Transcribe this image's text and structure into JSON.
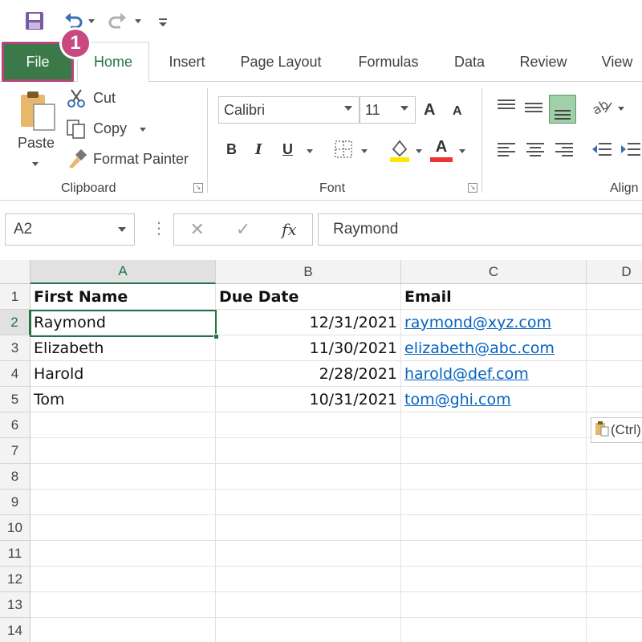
{
  "quick_access": {
    "save_icon": "save-icon",
    "undo_icon": "undo-icon",
    "redo_icon": "redo-icon",
    "customize_icon": "customize-qat-icon"
  },
  "tabs": [
    {
      "label": "File",
      "active": false
    },
    {
      "label": "Home",
      "active": true
    },
    {
      "label": "Insert"
    },
    {
      "label": "Page Layout"
    },
    {
      "label": "Formulas"
    },
    {
      "label": "Data"
    },
    {
      "label": "Review"
    },
    {
      "label": "View"
    }
  ],
  "step_badge": "1",
  "ribbon": {
    "clipboard": {
      "label": "Clipboard",
      "paste": "Paste",
      "cut": "Cut",
      "copy": "Copy",
      "format_painter": "Format Painter"
    },
    "font": {
      "label": "Font",
      "font_name": "Calibri",
      "font_size": "11",
      "bold": "B",
      "italic": "I",
      "underline": "U",
      "grow": "A",
      "shrink": "A",
      "font_color_letter": "A"
    },
    "alignment": {
      "label": "Align"
    }
  },
  "formula_bar": {
    "name_box": "A2",
    "cancel": "✕",
    "enter": "✓",
    "fx": "fx",
    "content": "Raymond"
  },
  "sheet": {
    "columns": [
      "A",
      "B",
      "C",
      "D"
    ],
    "rows": [
      "1",
      "2",
      "3",
      "4",
      "5",
      "6",
      "7",
      "8",
      "9",
      "10",
      "11",
      "12",
      "13",
      "14"
    ],
    "headers": [
      "First Name",
      "Due Date",
      "Email"
    ],
    "data": [
      [
        "Raymond",
        "12/31/2021",
        "raymond@xyz.com"
      ],
      [
        "Elizabeth",
        "11/30/2021",
        "elizabeth@abc.com"
      ],
      [
        "Harold",
        "2/28/2021",
        "harold@def.com"
      ],
      [
        "Tom",
        "10/31/2021",
        "tom@ghi.com"
      ]
    ],
    "paste_options": "(Ctrl)"
  },
  "colors": {
    "excel_green": "#217346",
    "file_tab": "#3b7a48",
    "highlight_badge": "#c8487f",
    "link": "#0563c1"
  }
}
